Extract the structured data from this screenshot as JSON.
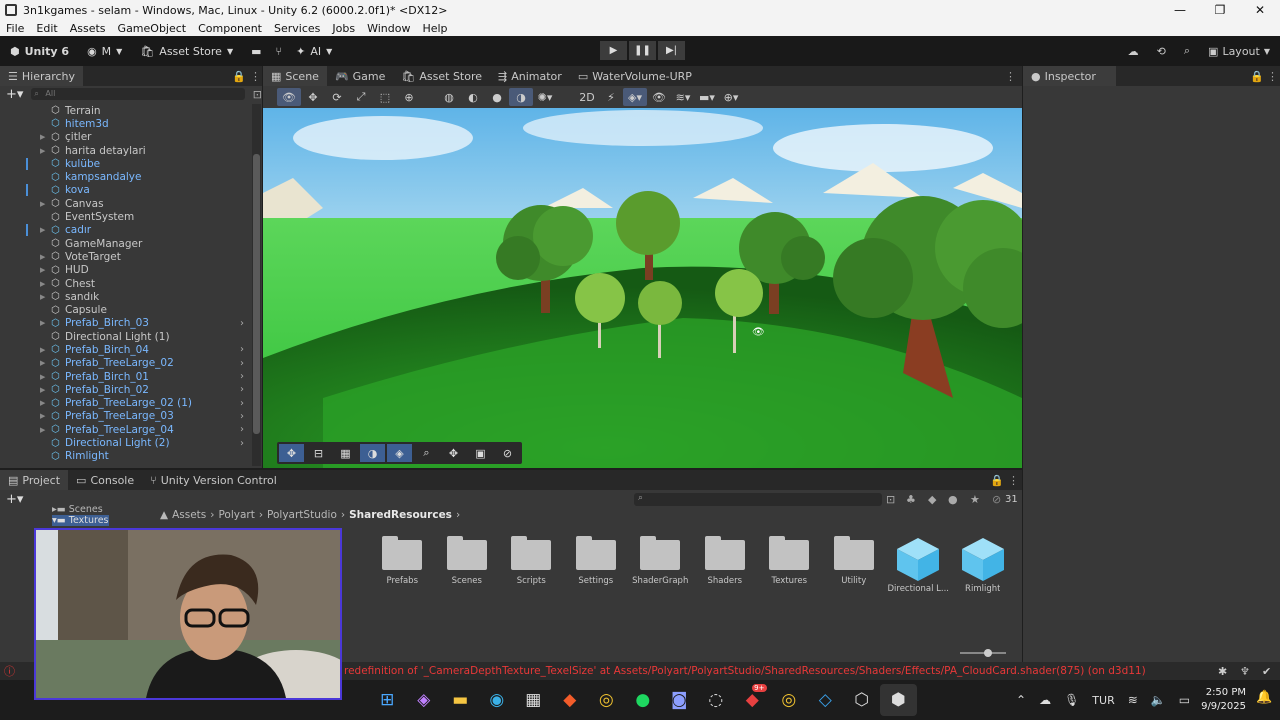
{
  "window": {
    "title": "3n1kgames - selam - Windows, Mac, Linux - Unity 6.2 (6000.2.0f1)* <DX12>",
    "controls": [
      "—",
      "❐",
      "✕"
    ]
  },
  "menu": [
    "File",
    "Edit",
    "Assets",
    "GameObject",
    "Component",
    "Services",
    "Jobs",
    "Window",
    "Help"
  ],
  "toolbar": {
    "unity_label": "Unity 6",
    "account": "M",
    "asset_store": "Asset Store",
    "ai": "AI",
    "layout": "Layout"
  },
  "hierarchy": {
    "tab": "Hierarchy",
    "search_placeholder": "All",
    "items": [
      {
        "label": "Terrain",
        "arrow": "",
        "prefab": false,
        "mark": false,
        "chevron": false
      },
      {
        "label": "hitem3d",
        "arrow": "",
        "prefab": true,
        "mark": false,
        "chevron": false
      },
      {
        "label": "çitler",
        "arrow": "▶",
        "prefab": false,
        "mark": false,
        "chevron": false
      },
      {
        "label": "harita detaylari",
        "arrow": "▶",
        "prefab": false,
        "mark": false,
        "chevron": false
      },
      {
        "label": "kulübe",
        "arrow": "",
        "prefab": true,
        "mark": true,
        "chevron": false
      },
      {
        "label": "kampsandalye",
        "arrow": "",
        "prefab": true,
        "mark": false,
        "chevron": false
      },
      {
        "label": "kova",
        "arrow": "",
        "prefab": true,
        "mark": true,
        "chevron": false
      },
      {
        "label": "Canvas",
        "arrow": "▶",
        "prefab": false,
        "mark": false,
        "chevron": false
      },
      {
        "label": "EventSystem",
        "arrow": "",
        "prefab": false,
        "mark": false,
        "chevron": false
      },
      {
        "label": "cadır",
        "arrow": "▶",
        "prefab": true,
        "mark": true,
        "chevron": false
      },
      {
        "label": "GameManager",
        "arrow": "",
        "prefab": false,
        "mark": false,
        "chevron": false
      },
      {
        "label": "VoteTarget",
        "arrow": "▶",
        "prefab": false,
        "mark": false,
        "chevron": false
      },
      {
        "label": "HUD",
        "arrow": "▶",
        "prefab": false,
        "mark": false,
        "chevron": false
      },
      {
        "label": "Chest",
        "arrow": "▶",
        "prefab": false,
        "mark": false,
        "chevron": false
      },
      {
        "label": "sandık",
        "arrow": "▶",
        "prefab": false,
        "mark": false,
        "chevron": false
      },
      {
        "label": "Capsule",
        "arrow": "",
        "prefab": false,
        "mark": false,
        "chevron": false
      },
      {
        "label": "Prefab_Birch_03",
        "arrow": "▶",
        "prefab": true,
        "mark": false,
        "chevron": true
      },
      {
        "label": "Directional Light (1)",
        "arrow": "",
        "prefab": false,
        "mark": false,
        "chevron": false
      },
      {
        "label": "Prefab_Birch_04",
        "arrow": "▶",
        "prefab": true,
        "mark": false,
        "chevron": true
      },
      {
        "label": "Prefab_TreeLarge_02",
        "arrow": "▶",
        "prefab": true,
        "mark": false,
        "chevron": true
      },
      {
        "label": "Prefab_Birch_01",
        "arrow": "▶",
        "prefab": true,
        "mark": false,
        "chevron": true
      },
      {
        "label": "Prefab_Birch_02",
        "arrow": "▶",
        "prefab": true,
        "mark": false,
        "chevron": true
      },
      {
        "label": "Prefab_TreeLarge_02 (1)",
        "arrow": "▶",
        "prefab": true,
        "mark": false,
        "chevron": true
      },
      {
        "label": "Prefab_TreeLarge_03",
        "arrow": "▶",
        "prefab": true,
        "mark": false,
        "chevron": true
      },
      {
        "label": "Prefab_TreeLarge_04",
        "arrow": "▶",
        "prefab": true,
        "mark": false,
        "chevron": true
      },
      {
        "label": "Directional Light (2)",
        "arrow": "",
        "prefab": true,
        "mark": false,
        "chevron": true
      },
      {
        "label": "Rimlight",
        "arrow": "",
        "prefab": true,
        "mark": false,
        "chevron": false
      }
    ]
  },
  "scene_tabs": [
    "Scene",
    "Game",
    "Asset Store",
    "Animator",
    "WaterVolume-URP"
  ],
  "inspector": {
    "tab": "Inspector"
  },
  "project": {
    "tabs": [
      "Project",
      "Console",
      "Unity Version Control"
    ],
    "hidden_count": "31",
    "tree": [
      "Scenes",
      "Textures"
    ],
    "breadcrumb": [
      "Assets",
      "Polyart",
      "PolyartStudio",
      "SharedResources"
    ],
    "assets": [
      {
        "name": "Prefabs",
        "kind": "folder"
      },
      {
        "name": "Scenes",
        "kind": "folder"
      },
      {
        "name": "Scripts",
        "kind": "folder"
      },
      {
        "name": "Settings",
        "kind": "folder"
      },
      {
        "name": "ShaderGraph",
        "kind": "folder"
      },
      {
        "name": "Shaders",
        "kind": "folder"
      },
      {
        "name": "Textures",
        "kind": "folder"
      },
      {
        "name": "Utility",
        "kind": "folder"
      },
      {
        "name": "Directional L...",
        "kind": "prefab"
      },
      {
        "name": "Rimlight",
        "kind": "prefab"
      }
    ]
  },
  "status": {
    "error": "redefinition of '_CameraDepthTexture_TexelSize' at Assets/Polyart/PolyartStudio/SharedResources/Shaders/Effects/PA_CloudCard.shader(875) (on d3d11)"
  },
  "taskbar": {
    "language": "TUR",
    "time": "2:50 PM",
    "date": "9/9/2025",
    "notification_badge": "9+"
  },
  "colors": {
    "editor_bg": "#383838",
    "prefab_text": "#7ab8ff",
    "error": "#e83838",
    "selection": "#3d5f93"
  }
}
